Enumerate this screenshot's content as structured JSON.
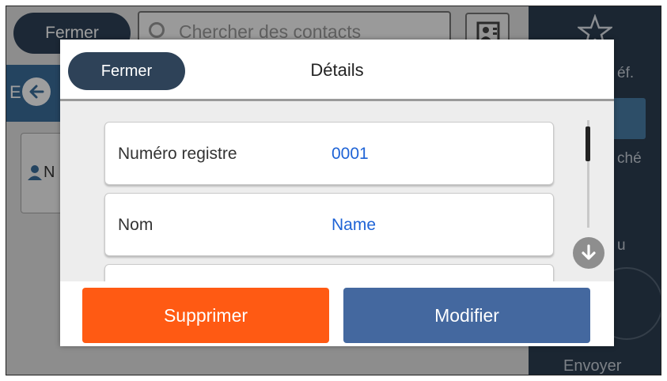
{
  "background": {
    "close_label": "Fermer",
    "search_placeholder": "Chercher des contacts",
    "right_panel": {
      "favorites_fragment": "éf.",
      "displayed_fragment": "ché",
      "fragment_2": "u",
      "send_label": "Envoyer"
    },
    "tab_fragment": "E",
    "card_fragment": "N"
  },
  "dialog": {
    "close_label": "Fermer",
    "title": "Détails",
    "rows": [
      {
        "label": "Numéro registre",
        "value": "0001"
      },
      {
        "label": "Nom",
        "value": "Name"
      }
    ],
    "delete_label": "Supprimer",
    "edit_label": "Modifier"
  },
  "colors": {
    "primary_dark": "#2e4258",
    "delete": "#ff5a13",
    "edit": "#44689f",
    "value_text": "#1e63d6"
  },
  "icons": {
    "back": "arrow-left-icon",
    "search": "search-icon",
    "contacts": "contact-book-icon",
    "favorite": "star-icon",
    "scroll_down": "arrow-down-icon"
  }
}
